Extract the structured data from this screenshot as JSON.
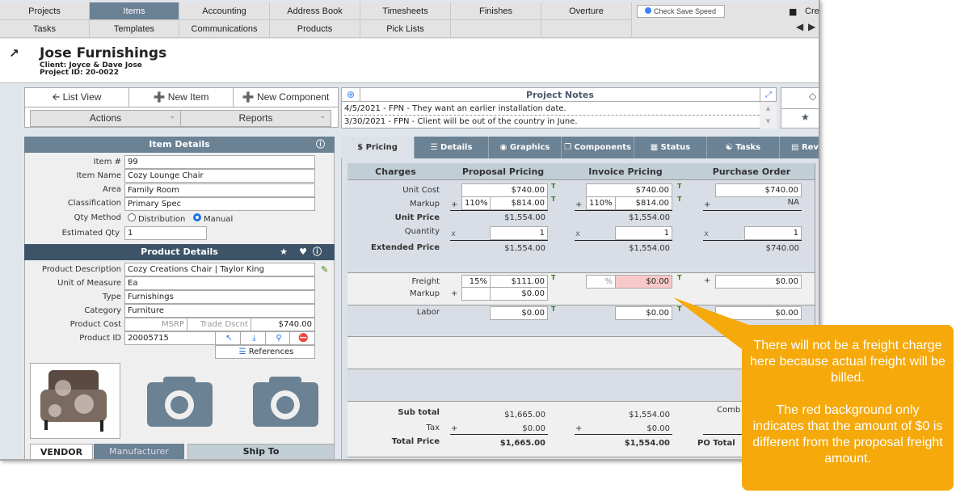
{
  "nav": {
    "row1": [
      "Projects",
      "Items",
      "Accounting",
      "Address Book",
      "Timesheets",
      "Finishes",
      "Overture"
    ],
    "row2": [
      "Tasks",
      "Templates",
      "Communications",
      "Products",
      "Pick Lists",
      "",
      ""
    ],
    "active": "Items",
    "check_save_speed": "Check Save Speed",
    "create_label": "Cre"
  },
  "header": {
    "title": "Jose Furnishings",
    "client": "Client: Joyce & Dave Jose",
    "project_id": "Project ID: 20-0022"
  },
  "toolbar": {
    "list_view": "List View",
    "new_item": "New Item",
    "new_component": "New Component",
    "actions": "Actions",
    "reports": "Reports"
  },
  "notes": {
    "title": "Project Notes",
    "lines": [
      "4/5/2021 - FPN - They want an earlier installation date.",
      "3/30/2021 - FPN - Client will be out of the country in June."
    ]
  },
  "item_details": {
    "title": "Item Details",
    "fields": [
      {
        "label": "Item #",
        "value": "99"
      },
      {
        "label": "Item Name",
        "value": "Cozy Lounge Chair"
      },
      {
        "label": "Area",
        "value": "Family Room"
      },
      {
        "label": "Classification",
        "value": "Primary Spec"
      }
    ],
    "qty_method_label": "Qty Method",
    "qty_options": [
      "Distribution",
      "Manual"
    ],
    "qty_selected": "Manual",
    "est_qty_label": "Estimated Qty",
    "est_qty": "1"
  },
  "product_details": {
    "title": "Product Details",
    "fields": [
      {
        "label": "Product Description",
        "value": "Cozy Creations Chair | Taylor King"
      },
      {
        "label": "Unit of Measure",
        "value": "Ea"
      },
      {
        "label": "Type",
        "value": "Furnishings"
      },
      {
        "label": "Category",
        "value": "Furniture"
      }
    ],
    "cost_label": "Product Cost",
    "msrp": "MSRP",
    "trade_dscnt": "Trade Dscnt",
    "cost": "$740.00",
    "id_label": "Product ID",
    "id": "20005715",
    "references": "References"
  },
  "bottom_tabs": [
    "VENDOR",
    "Manufacturer",
    "Ship To"
  ],
  "tabs": [
    "Pricing",
    "Details",
    "Graphics",
    "Components",
    "Status",
    "Tasks",
    "Revi"
  ],
  "pricing": {
    "headers": [
      "Charges",
      "Proposal Pricing",
      "Invoice Pricing",
      "Purchase Order"
    ],
    "labels": {
      "unit_cost": "Unit Cost",
      "markup": "Markup",
      "unit_price": "Unit Price",
      "quantity": "Quantity",
      "extended_price": "Extended Price",
      "freight": "Freight",
      "freight_markup": "Markup",
      "labor": "Labor",
      "sub_total": "Sub total",
      "tax": "Tax",
      "total_price": "Total Price",
      "po_total": "PO Total",
      "comb": "Comb"
    },
    "proposal": {
      "unit_cost": "$740.00",
      "markup_pct": "110%",
      "markup": "$814.00",
      "unit_price": "$1,554.00",
      "quantity": "1",
      "extended": "$1,554.00",
      "freight_pct": "15%",
      "freight": "$111.00",
      "freight_markup": "$0.00",
      "labor": "$0.00",
      "sub_total": "$1,665.00",
      "tax": "$0.00",
      "total": "$1,665.00"
    },
    "invoice": {
      "unit_cost": "$740.00",
      "markup_pct": "110%",
      "markup": "$814.00",
      "unit_price": "$1,554.00",
      "quantity": "1",
      "extended": "$1,554.00",
      "freight_pct": "%",
      "freight": "$0.00",
      "labor": "$0.00",
      "sub_total": "$1,554.00",
      "tax": "$0.00",
      "total": "$1,554.00"
    },
    "po": {
      "unit_cost": "$740.00",
      "markup": "NA",
      "quantity": "1",
      "extended": "$740.00",
      "freight": "$0.00",
      "labor": "$0.00"
    },
    "sym": {
      "plus": "+",
      "times": "x",
      "t": "T"
    },
    "mismatch_color": "#f9c9c9"
  },
  "callout": {
    "p1": "There will not be a freight charge here because actual freight will be billed.",
    "p2": "The red background only indicates that the amount of $0 is different from the proposal freight amount.",
    "color": "#f5a90a"
  }
}
